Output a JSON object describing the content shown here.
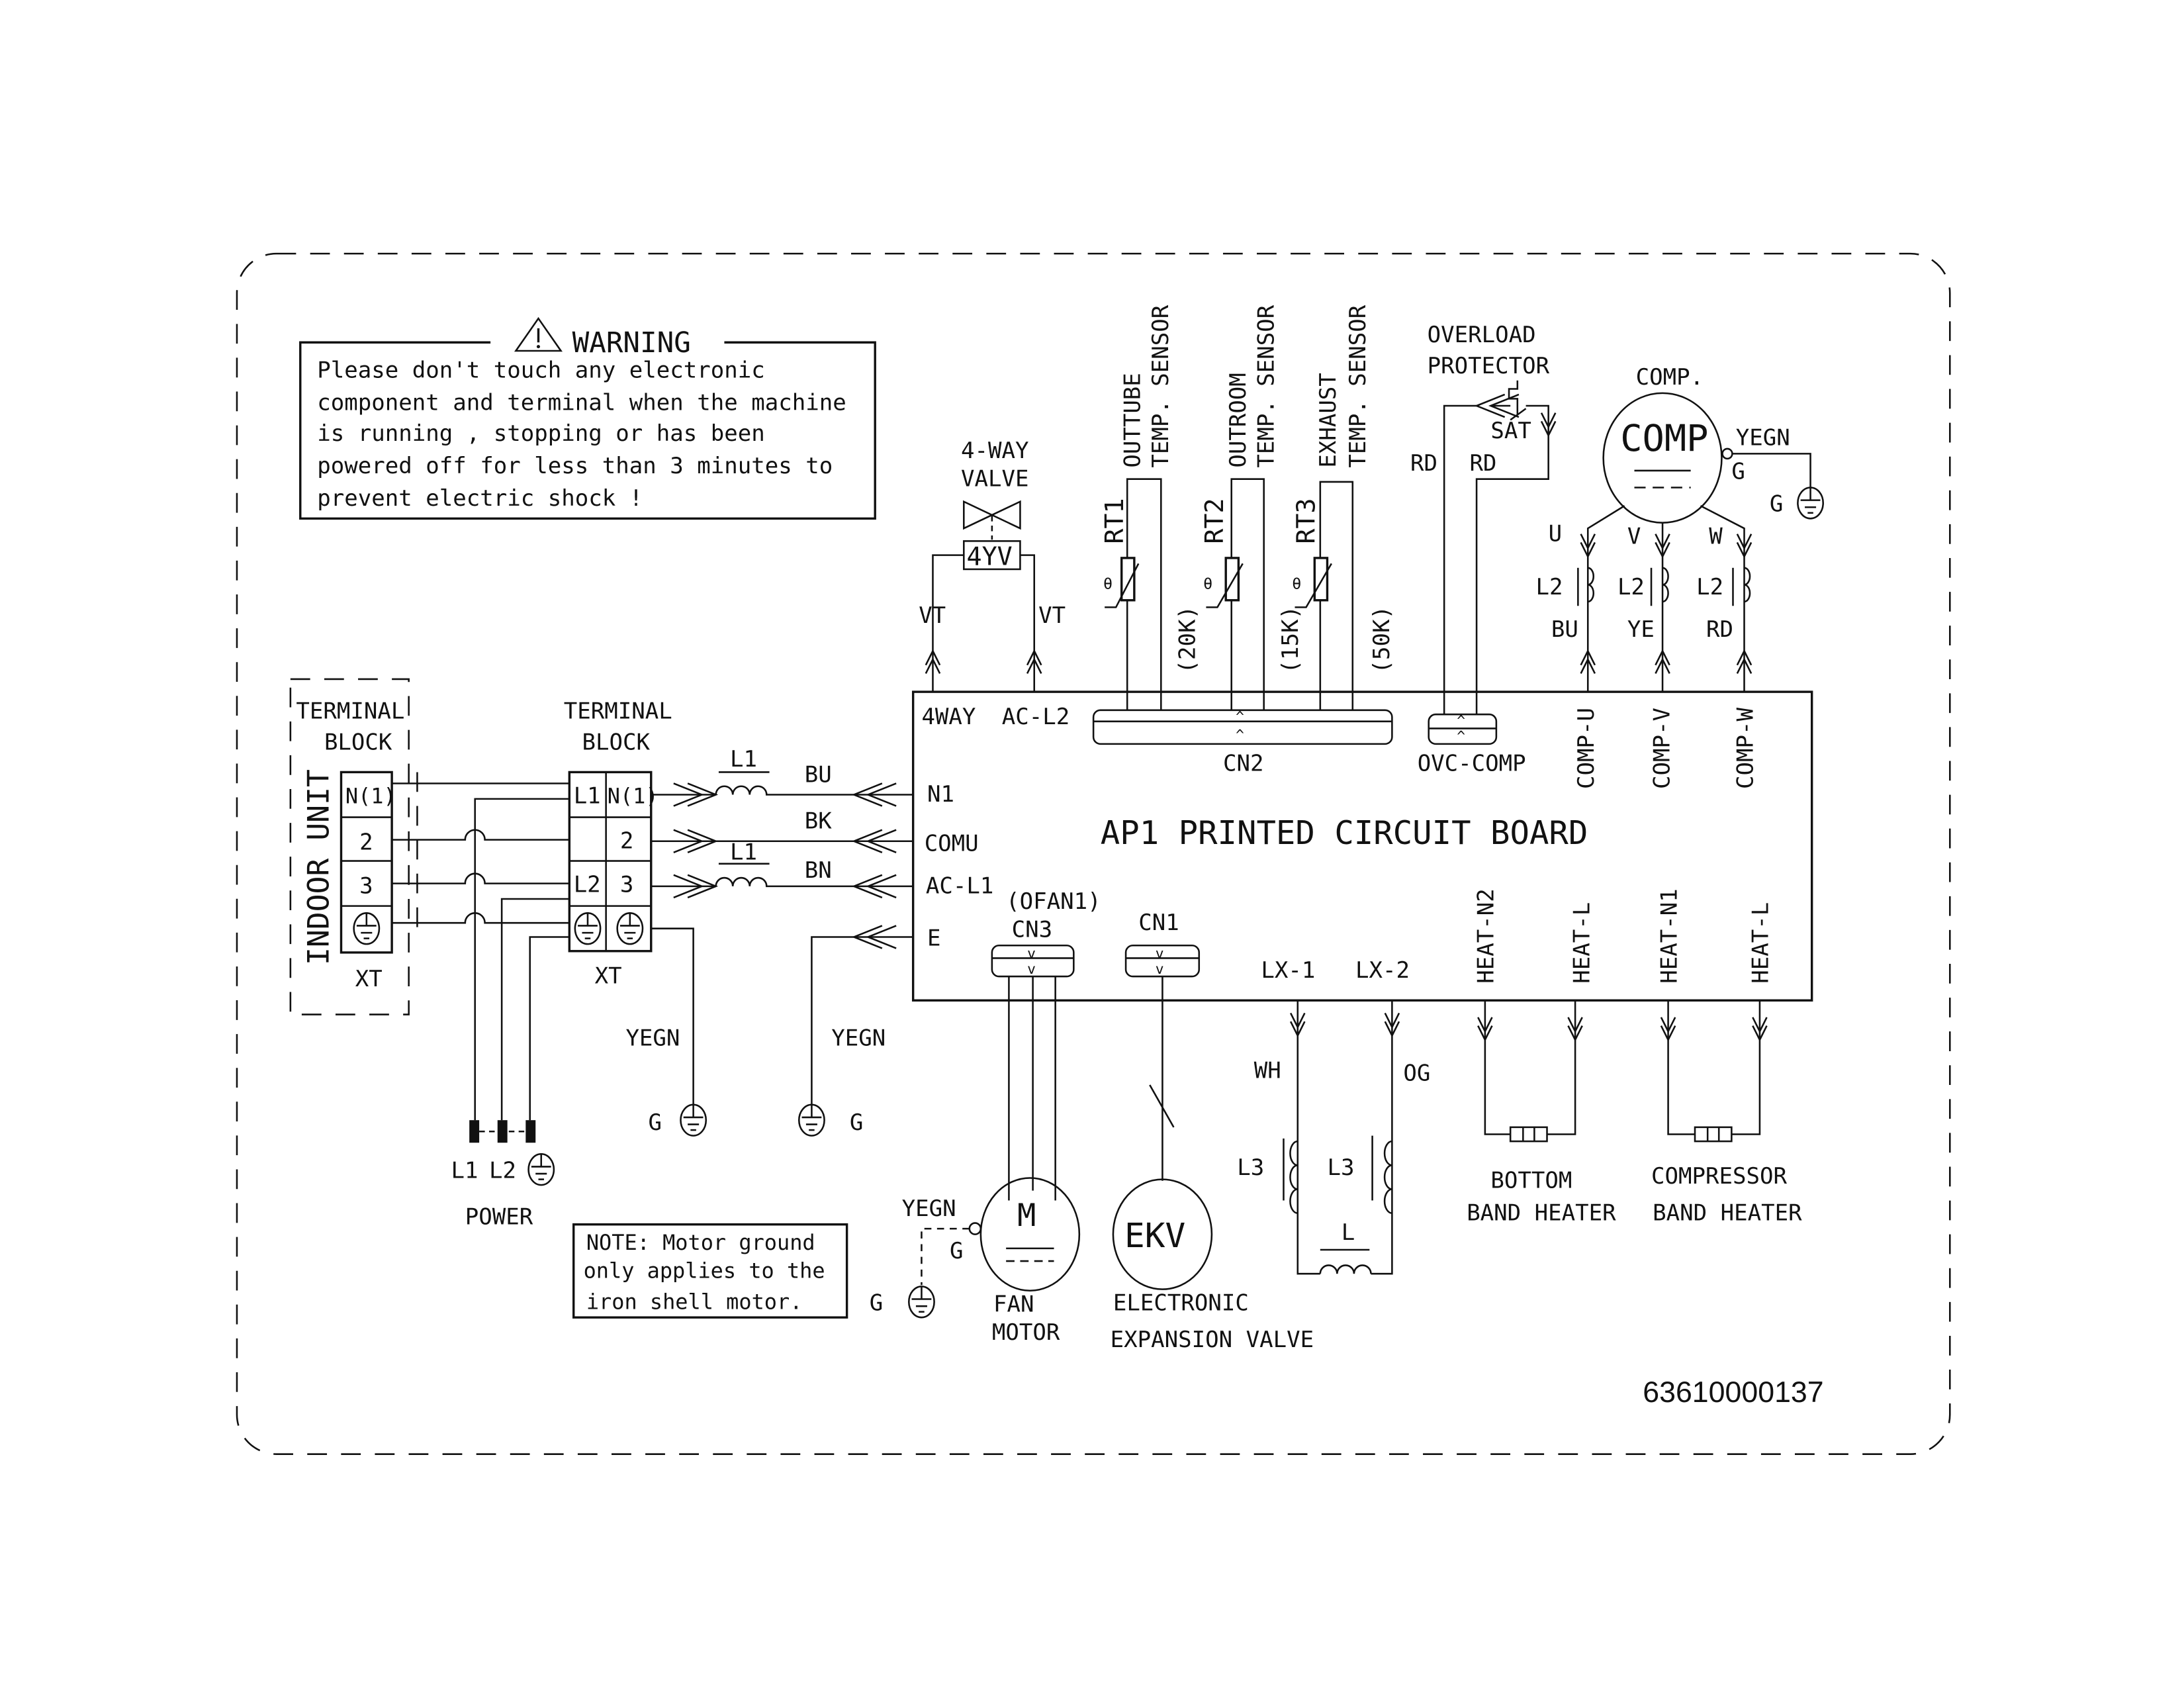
{
  "warning": {
    "title": "WARNING",
    "lines": [
      "Please don't touch any electronic",
      "component and terminal when the machine",
      "is running , stopping or has been",
      "powered off for less than 3 minutes to",
      "prevent electric shock !"
    ]
  },
  "indoor_unit": {
    "label": "INDOOR UNIT",
    "block_title": [
      "TERMINAL",
      "BLOCK"
    ],
    "terminals": [
      "N(1)",
      "2",
      "3",
      "ground"
    ],
    "xt": "XT"
  },
  "outdoor_terminal": {
    "block_title": [
      "TERMINAL",
      "BLOCK"
    ],
    "left_terminals": [
      "L1",
      "",
      "L2",
      "ground"
    ],
    "right_terminals": [
      "N(1)",
      "2",
      "3",
      "ground"
    ],
    "xt": "XT"
  },
  "power": {
    "label": "POWER",
    "terminals": [
      "L1",
      "L2",
      "ground"
    ]
  },
  "line_wires": [
    {
      "inductor": "L1",
      "color": "BU",
      "pcb_pin": "N1"
    },
    {
      "inductor": "",
      "color": "BK",
      "pcb_pin": "COMU"
    },
    {
      "inductor": "L1",
      "color": "BN",
      "pcb_pin": "AC-L1"
    },
    {
      "inductor": "",
      "color": "",
      "pcb_pin": "E"
    }
  ],
  "grounds": {
    "yegn": "YEGN",
    "g": "G"
  },
  "four_way_valve": {
    "title": [
      "4-WAY",
      "VALVE"
    ],
    "code": "4YV",
    "wire_left": "VT",
    "wire_right": "VT",
    "pins": [
      "4WAY",
      "AC-L2"
    ]
  },
  "sensors": [
    {
      "id": "RT1",
      "name": [
        "OUTTUBE",
        "TEMP. SENSOR"
      ],
      "resistance": "(20K)"
    },
    {
      "id": "RT2",
      "name": [
        "OUTROOM",
        "TEMP. SENSOR"
      ],
      "resistance": "(15K)"
    },
    {
      "id": "RT3",
      "name": [
        "EXHAUST",
        "TEMP. SENSOR"
      ],
      "resistance": "(50K)"
    }
  ],
  "sensor_connector": "CN2",
  "overload": {
    "title": [
      "OVERLOAD",
      "PROTECTOR"
    ],
    "code": "SAT",
    "wires": [
      "RD",
      "RD"
    ],
    "connector": "OVC-COMP"
  },
  "compressor": {
    "title": "COMP.",
    "symbol": "COMP",
    "ground_wire": "YEGN",
    "ground_label": "G",
    "phases": [
      {
        "phase": "U",
        "inductor": "L2",
        "color": "BU",
        "pin": "COMP-U"
      },
      {
        "phase": "V",
        "inductor": "L2",
        "color": "YE",
        "pin": "COMP-V"
      },
      {
        "phase": "W",
        "inductor": "L2",
        "color": "RD",
        "pin": "COMP-W"
      }
    ]
  },
  "pcb": {
    "title": "AP1 PRINTED CIRCUIT BOARD",
    "fan_connector": [
      "(OFAN1)",
      "CN3"
    ],
    "ekv_connector": "CN1",
    "lx_pins": [
      "LX-1",
      "LX-2"
    ],
    "heat_pins": [
      "HEAT-N2",
      "HEAT-L",
      "HEAT-N1",
      "HEAT-L"
    ]
  },
  "fan_motor": {
    "symbol": "M",
    "label": [
      "FAN",
      "MOTOR"
    ],
    "ground_wire": "YEGN",
    "ground_label": "G"
  },
  "ekv": {
    "symbol": "EKV",
    "label": [
      "ELECTRONIC",
      "EXPANSION VALVE"
    ]
  },
  "reactor": {
    "wire_left": "WH",
    "wire_right": "OG",
    "coil_left": "L3",
    "coil_right": "L3",
    "bottom": "L"
  },
  "heaters": [
    {
      "label": [
        "BOTTOM",
        "BAND HEATER"
      ]
    },
    {
      "label": [
        "COMPRESSOR",
        "BAND HEATER"
      ]
    }
  ],
  "note": {
    "lines": [
      "NOTE: Motor ground",
      "only applies to the",
      "iron shell motor."
    ]
  },
  "part_number": "63610000137"
}
